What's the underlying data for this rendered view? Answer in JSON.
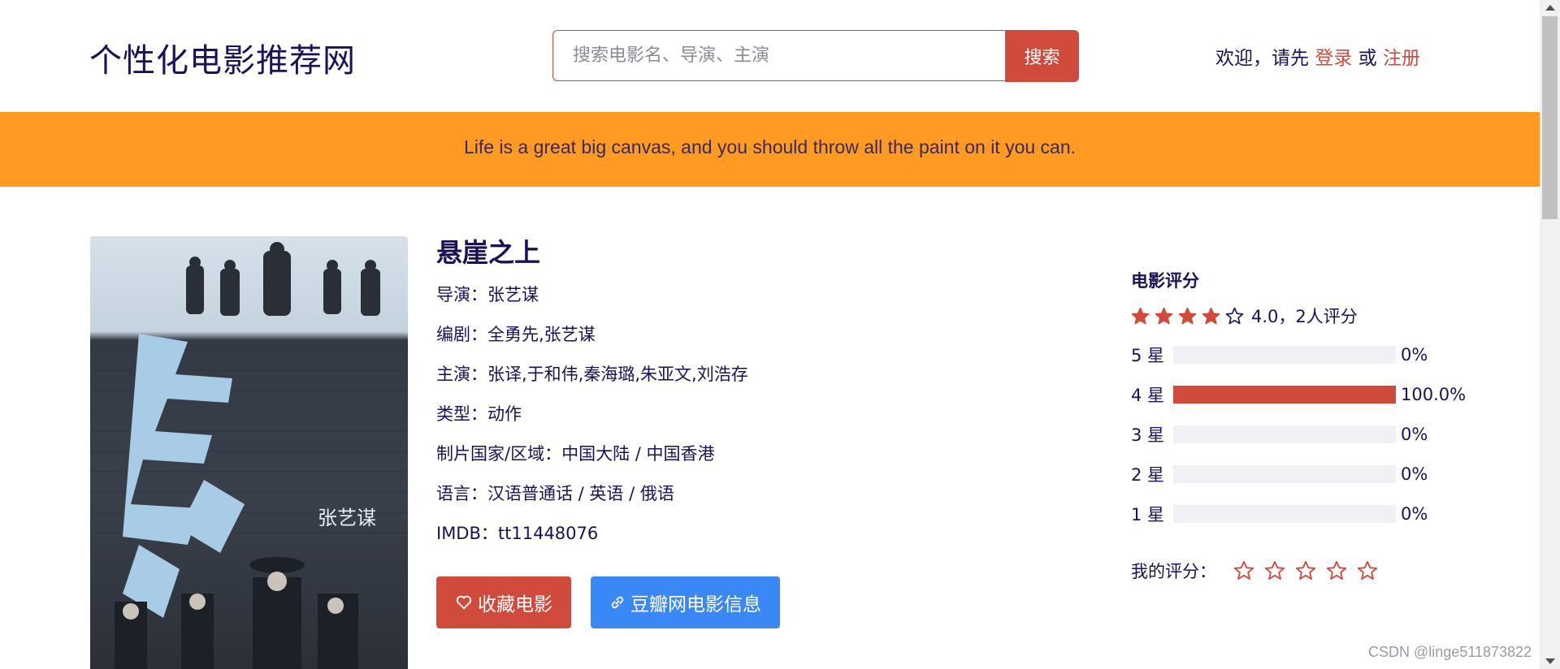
{
  "header": {
    "site_title": "个性化电影推荐网",
    "search": {
      "placeholder": "搜索电影名、导演、主演",
      "value": "",
      "button_label": "搜索"
    },
    "welcome": {
      "prefix": "欢迎，请先",
      "login_label": "登录",
      "connector": "或",
      "register_label": "注册"
    }
  },
  "banner": {
    "quote": "Life is a great big canvas, and you should throw all the paint on it you can."
  },
  "movie": {
    "title": "悬崖之上",
    "director": {
      "label": "导演：",
      "value": "张艺谋"
    },
    "writers": {
      "label": "编剧：",
      "value": "全勇先,张艺谋"
    },
    "cast": {
      "label": "主演：",
      "value": "张译,于和伟,秦海璐,朱亚文,刘浩存"
    },
    "genre": {
      "label": "类型：",
      "value": "动作"
    },
    "region": {
      "label": "制片国家/区域：",
      "value": "中国大陆 / 中国香港"
    },
    "language": {
      "label": "语言：",
      "value": "汉语普通话 / 英语 / 俄语"
    },
    "imdb": {
      "label": "IMDB：",
      "value": "tt11448076"
    },
    "poster": {
      "icon": "movie-poster-image",
      "text": "张艺谋"
    },
    "actions": {
      "favorite_label": "收藏电影",
      "favorite_icon": "heart-outline-icon",
      "douban_label": "豆瓣网电影信息",
      "douban_icon": "link-icon"
    }
  },
  "rating": {
    "heading": "电影评分",
    "stars_filled": 4,
    "stars_total": 5,
    "summary": "4.0，2人评分",
    "distribution": [
      {
        "label": "5 星",
        "fraction": 0.0,
        "percent": "0%"
      },
      {
        "label": "4 星",
        "fraction": 1.0,
        "percent": "100.0%"
      },
      {
        "label": "3 星",
        "fraction": 0.0,
        "percent": "0%"
      },
      {
        "label": "2 星",
        "fraction": 0.0,
        "percent": "0%"
      },
      {
        "label": "1 星",
        "fraction": 0.0,
        "percent": "0%"
      }
    ],
    "my_rating_label": "我的评分：",
    "my_rating_stars": 0
  },
  "watermark": "CSDN @linge511873822",
  "colors": {
    "accent": "#d14b3c",
    "banner": "#ff9a23",
    "link_button": "#3a88f5",
    "title_text": "#1a1258",
    "bar_track": "#f0f1f5"
  }
}
